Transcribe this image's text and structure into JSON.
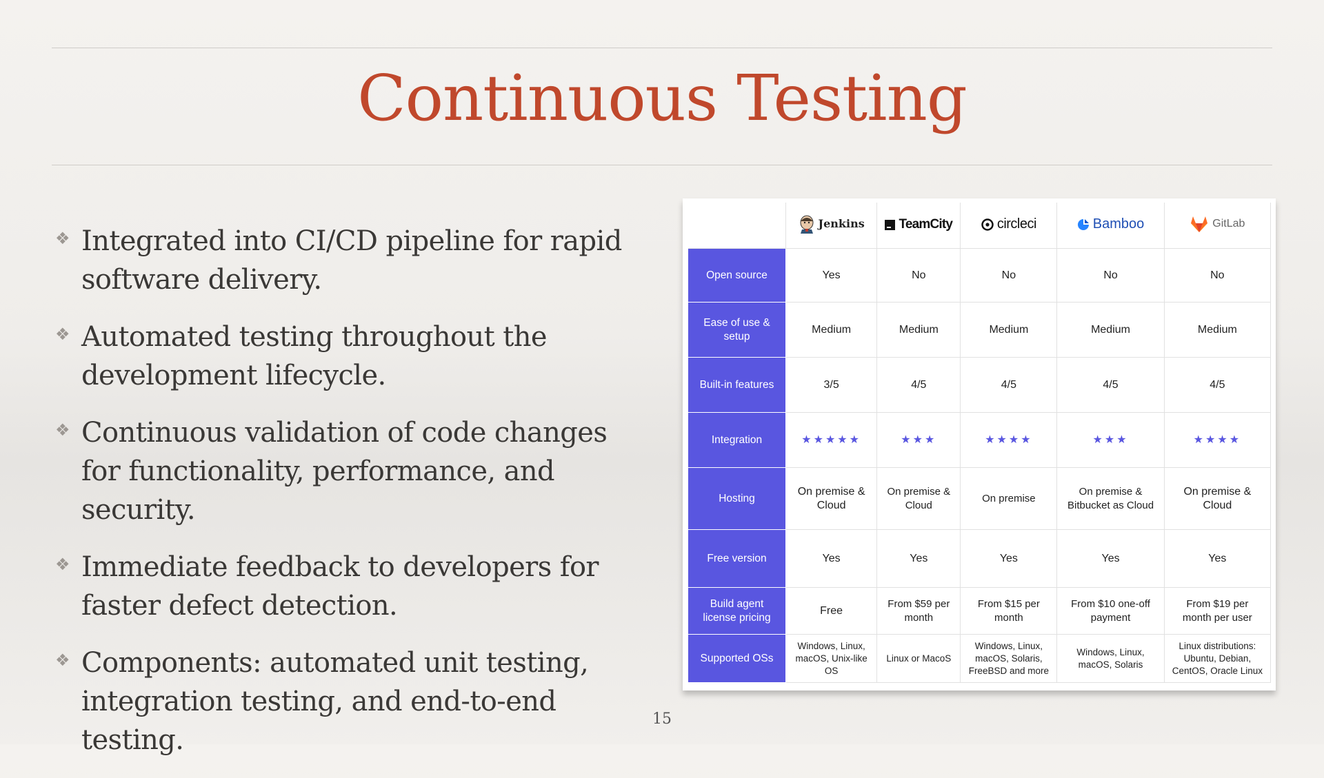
{
  "slide": {
    "title": "Continuous Testing",
    "page_number": "15",
    "bullets": [
      "Integrated into CI/CD pipeline for rapid software delivery.",
      "Automated testing throughout the development lifecycle.",
      "Continuous validation of code changes for functionality, performance, and security.",
      "Immediate feedback to developers for faster defect detection.",
      "Components: automated unit testing, integration testing, and end-to-end testing."
    ],
    "bullet_icon": "diamond-flower-icon"
  },
  "table": {
    "accent_color": "#5956e0",
    "tools": [
      {
        "name": "Jenkins",
        "icon": "jenkins-butler-icon"
      },
      {
        "name": "TeamCity",
        "icon": "teamcity-icon"
      },
      {
        "name": "circleci",
        "icon": "circleci-icon"
      },
      {
        "name": "Bamboo",
        "icon": "bamboo-icon"
      },
      {
        "name": "GitLab",
        "icon": "gitlab-fox-icon"
      }
    ],
    "rows": [
      {
        "label": "Open source",
        "values": [
          "Yes",
          "No",
          "No",
          "No",
          "No"
        ]
      },
      {
        "label": "Ease of use & setup",
        "values": [
          "Medium",
          "Medium",
          "Medium",
          "Medium",
          "Medium"
        ]
      },
      {
        "label": "Built-in features",
        "values": [
          "3/5",
          "4/5",
          "4/5",
          "4/5",
          "4/5"
        ]
      },
      {
        "label": "Integration",
        "values": [
          "★★★★★",
          "★★★",
          "★★★★",
          "★★★",
          "★★★★"
        ],
        "ratings": [
          5,
          3,
          4,
          3,
          4
        ]
      },
      {
        "label": "Hosting",
        "values": [
          "On premise & Cloud",
          "On premise & Cloud",
          "On premise",
          "On premise & Bitbucket as Cloud",
          "On premise & Cloud"
        ]
      },
      {
        "label": "Free version",
        "values": [
          "Yes",
          "Yes",
          "Yes",
          "Yes",
          "Yes"
        ]
      },
      {
        "label": "Build agent license pricing",
        "values": [
          "Free",
          "From $59 per month",
          "From $15 per month",
          "From $10 one-off payment",
          "From $19 per month per user"
        ]
      },
      {
        "label": "Supported OSs",
        "values": [
          "Windows, Linux, macOS, Unix-like OS",
          "Linux or MacoS",
          "Windows, Linux, macOS, Solaris, FreeBSD and more",
          "Windows, Linux, macOS, Solaris",
          "Linux distributions: Ubuntu, Debian, CentOS, Oracle Linux"
        ]
      }
    ]
  }
}
